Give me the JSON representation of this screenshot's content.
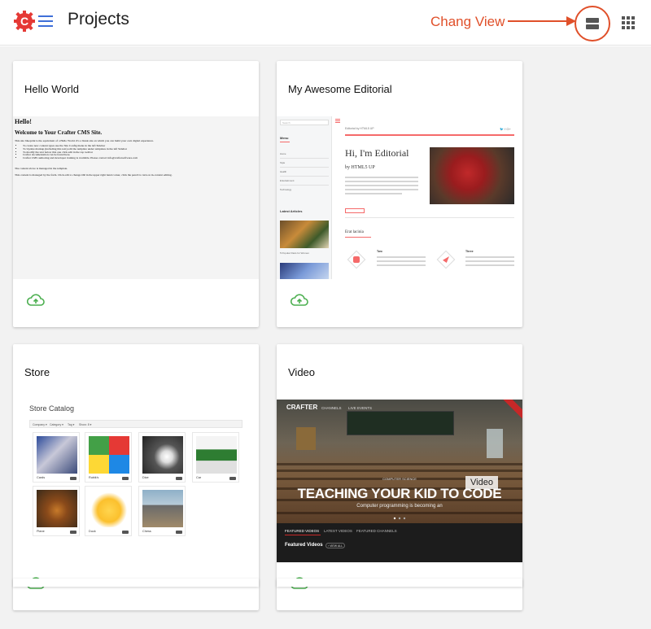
{
  "header": {
    "title": "Projects",
    "annotation_label": "Chang View",
    "annotation_color": "#e0502a",
    "accent_color": "#e53935",
    "icons": [
      "crafter-logo-icon",
      "hamburger-menu-icon",
      "list-view-icon",
      "grid-view-icon"
    ]
  },
  "cards": [
    {
      "title": "Hello World",
      "preview": {
        "heading": "Hello!",
        "subheading": "Welcome to Your Crafter CMS Site.",
        "body1": "This site blueprint is the equivalent of a Hello World. It's a blank site on which you can build your own digital experience.",
        "bullets": [
          "To create new content types use the Site Config menu in the left Sidebar",
          "To Update markup (including this text) edit the template under templates in the left Sidebar",
          "To modify the text below this one click edit in the top toolbar",
          "Crafter documentation can be found here.",
          "Crafter CMS authoring and developer training is available. Please contact info@craftersoftware.com"
        ],
        "body2": "The content above is managed in the template.",
        "body3": "This content is managed by the form. Click edit to change OR in the upper right hand corner, click the pencil to turn on in-context editing."
      },
      "action_icon": "cloud-upload-icon"
    },
    {
      "title": "My Awesome Editorial",
      "preview": {
        "search": "Search",
        "menu": "Menu",
        "menu_items": [
          "Home",
          "Style",
          "Health",
          "Entertainment",
          "Technology"
        ],
        "latest": "Latest Articles",
        "latest_item": "5 Popular Diets for Women",
        "header_small": "Editorial by HTML5 UP",
        "heading": "Hi, I'm Editorial",
        "byline": "by HTML5 UP",
        "section": "Erat lacinia",
        "feature1": "Two",
        "feature2": "Three"
      },
      "action_icon": "cloud-upload-icon"
    },
    {
      "title": "Store",
      "preview": {
        "catalog_title": "Store Catalog",
        "filters": [
          "Company ▾",
          "Category ▾",
          "Tag ▾",
          "Show: 8 ▾"
        ],
        "products": [
          "Cards",
          "Rubik's",
          "Dice",
          "Car",
          "Plane",
          "Duck",
          "Chess"
        ]
      },
      "action_icon": "cloud-upload-icon"
    },
    {
      "title": "Video",
      "preview": {
        "brand": "CRAFTER",
        "nav": [
          "CHANNELS",
          "LIVE EVENTS"
        ],
        "kicker": "COMPUTER SCIENCE",
        "headline": "TEACHING YOUR KID TO CODE",
        "subtitle": "Computer programming is becoming an",
        "badge": "Video",
        "tabs": [
          "FEATURED VIDEOS",
          "LATEST VIDEOS",
          "FEATURED CHANNELS"
        ],
        "featured_label": "Featured Videos",
        "view_all": "VIEW ALL"
      },
      "action_icon": "cloud-upload-icon"
    }
  ]
}
